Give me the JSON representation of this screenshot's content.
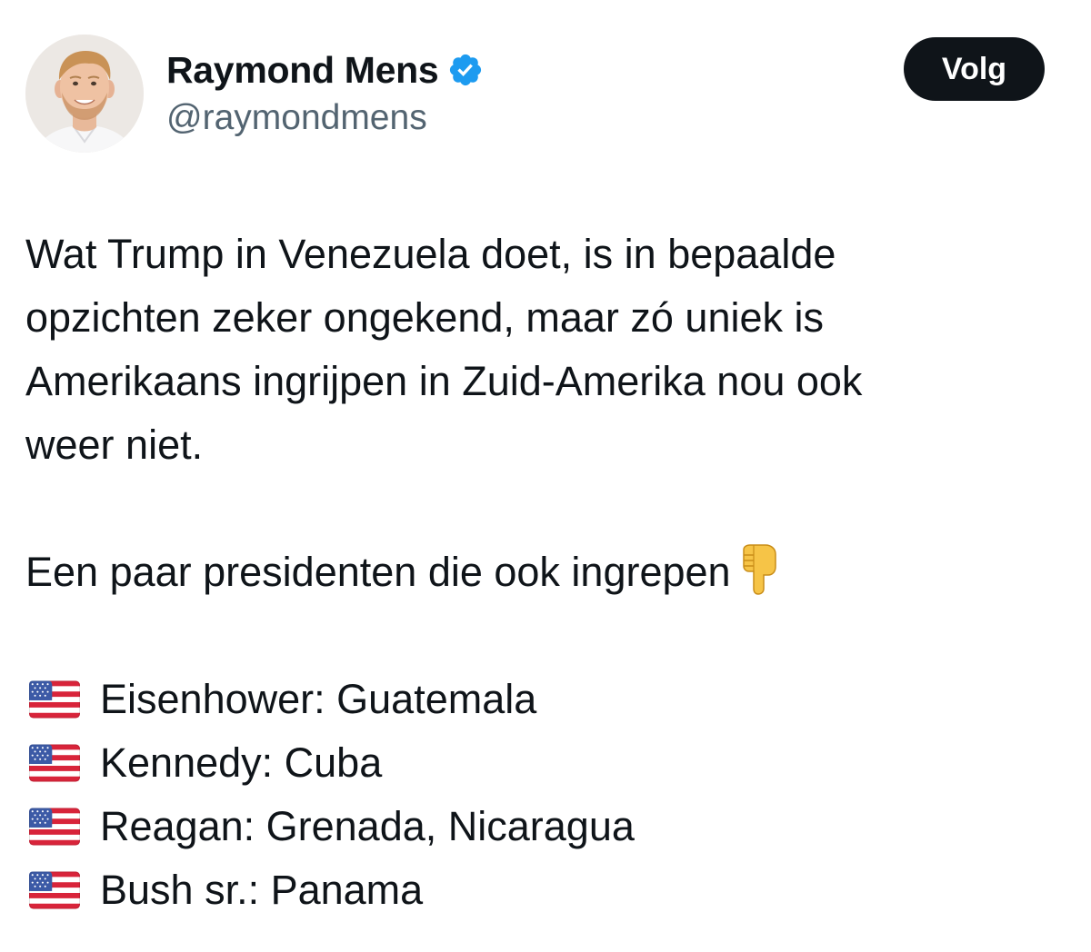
{
  "author": {
    "display_name": "Raymond Mens",
    "handle": "@raymondmens",
    "verified_icon": "verified-badge-icon",
    "avatar_icon": "profile-photo-avatar"
  },
  "actions": {
    "follow_label": "Volg"
  },
  "tweet": {
    "paragraph_1_lines": [
      "Wat Trump in Venezuela doet, is in bepaalde",
      "opzichten zeker ongekend, maar zó uniek is",
      "Amerikaans ingrijpen in Zuid-Amerika nou ook",
      "weer niet."
    ],
    "intro": "Een paar presidenten die ook ingrepen",
    "intro_emoji_icon": "pointing-down-hand-icon",
    "list_icon": "us-flag-icon",
    "list": [
      "Eisenhower: Guatemala",
      "Kennedy: Cuba",
      "Reagan: Grenada, Nicaragua",
      "Bush sr.: Panama"
    ]
  },
  "colors": {
    "text": "#0f1419",
    "secondary_text": "#536471",
    "verified_blue": "#1d9bf0",
    "button_bg": "#0f1419",
    "button_text": "#ffffff"
  }
}
